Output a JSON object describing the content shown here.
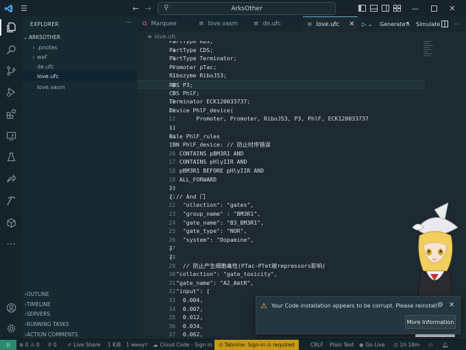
{
  "titlebar": {
    "search_text": "ArksOther",
    "icons": [
      "vscode-logo-icon",
      "menu-icon",
      "back-arrow-icon",
      "forward-arrow-icon",
      "search-icon",
      "toggle-sidebar-icon",
      "toggle-panel-icon",
      "toggle-secondary-sidebar-icon",
      "customize-layout-icon",
      "minimize-icon",
      "maximize-icon",
      "close-icon"
    ]
  },
  "activity_bar": [
    "explorer-icon",
    "search-icon",
    "source-control-icon",
    "run-debug-icon",
    "extensions-icon",
    "remote-explorer-icon",
    "testing-icon",
    "live-share-icon",
    "pickaxe-icon",
    "package-icon",
    "more-icon",
    "accounts-icon",
    "settings-gear-icon"
  ],
  "sidebar": {
    "title": "EXPLORER",
    "menu": "···",
    "root": "ARKSOTHER",
    "items": [
      {
        "label": ".pnotes",
        "type": "folder"
      },
      {
        "label": "waf",
        "type": "folder"
      },
      {
        "label": "de.ufc",
        "type": "file"
      },
      {
        "label": "love.ufc",
        "type": "file"
      },
      {
        "label": "love.vasm",
        "type": "file"
      }
    ],
    "panels": [
      "OUTLINE",
      "TIMELINE",
      "SERVERS",
      "RUNNING TASKS",
      "ACTION COMMENTS"
    ]
  },
  "tabs": [
    {
      "label": "Marquee"
    },
    {
      "label": "love.vasm"
    },
    {
      "label": "de.ufc"
    },
    {
      "label": "love.ufc",
      "close": "✕"
    }
  ],
  "editor_actions": {
    "generate": "Generate",
    "simulate": "Simulate"
  },
  "breadcrumb": "love.ufc",
  "code": [
    {
      "n": "3",
      "t": "PartType RBS;"
    },
    {
      "n": "4",
      "t": "PartType CDS;"
    },
    {
      "n": "5",
      "t": "PartType Terminator;"
    },
    {
      "n": "6",
      "t": "Promoter pTac;"
    },
    {
      "n": "7",
      "t": "Ribozyme RiboJ53;"
    },
    {
      "n": "8",
      "t": "RBS P3;"
    },
    {
      "n": "9",
      "t": "CDS PhlF;"
    },
    {
      "n": "10",
      "t": "Terminator ECK120033737;"
    },
    {
      "n": "11",
      "t": "Device PhlF_device("
    },
    {
      "n": "12",
      "t": "        Promoter, Promoter, RiboJ53, P3, PhlF, ECK120033737"
    },
    {
      "n": "13",
      "t": ");"
    },
    {
      "n": "14",
      "t": "Rule PhlF_rules"
    },
    {
      "n": "15",
      "t": "(ON PhlF_device: // 防止时序错误"
    },
    {
      "n": "16",
      "t": "   CONTAINS pBM3R1 AND"
    },
    {
      "n": "17",
      "t": "   CONTAINS pHlyIIR AND"
    },
    {
      "n": "18",
      "t": "   pBM3R1 BEFORE pHlyIIR AND"
    },
    {
      "n": "19",
      "t": "   ALL_FORWARD"
    },
    {
      "n": "20",
      "t": ");"
    },
    {
      "n": "21",
      "t": "{ // And 门"
    },
    {
      "n": "22",
      "t": "    \"ollection\": \"gates\","
    },
    {
      "n": "23",
      "t": "    \"group_name\" : \"BM3R1\","
    },
    {
      "n": "24",
      "t": "    \"gate_name\": \"B3_BM3R1\","
    },
    {
      "n": "25",
      "t": "    \"gate_type\": \"NOR\","
    },
    {
      "n": "26",
      "t": "    \"system\": \"Dopamine\","
    },
    {
      "n": "27",
      "t": "}"
    },
    {
      "n": "28",
      "t": "{"
    },
    {
      "n": "29",
      "t": "    // 防止产生细胞毒性(PTac-PTet被repressors影响)"
    },
    {
      "n": "30",
      "t": "  \"collection\": \"gate_toxicity\","
    },
    {
      "n": "31",
      "t": "  \"gate_name\": \"A2_AmtR\","
    },
    {
      "n": "32",
      "t": "  \"input\": ["
    },
    {
      "n": "33",
      "t": "    0.004,"
    },
    {
      "n": "34",
      "t": "    0.007,"
    },
    {
      "n": "35",
      "t": "    0.012,"
    },
    {
      "n": "36",
      "t": "    0.034,"
    },
    {
      "n": "37",
      "t": "    0.062,"
    }
  ],
  "current_line": "8",
  "notification": {
    "message": "Your Code installation appears to be corrupt. Please reinstall.",
    "button": "More Information"
  },
  "statusbar": {
    "remote": "⟩⟨",
    "problems": "⊗ 0 ⚠ 0",
    "ports": "⚲ 0",
    "live_share": "Live Share",
    "size": "1 KiB",
    "time_spent": "1 минут",
    "cloud_code": "Cloud Code - Sign in",
    "tabnine": "⊙ Tabnine: Sign-in is required",
    "eol": "CRLF",
    "language": "Plain Text",
    "go_live": "Go Live",
    "clock": "1h 18m"
  }
}
